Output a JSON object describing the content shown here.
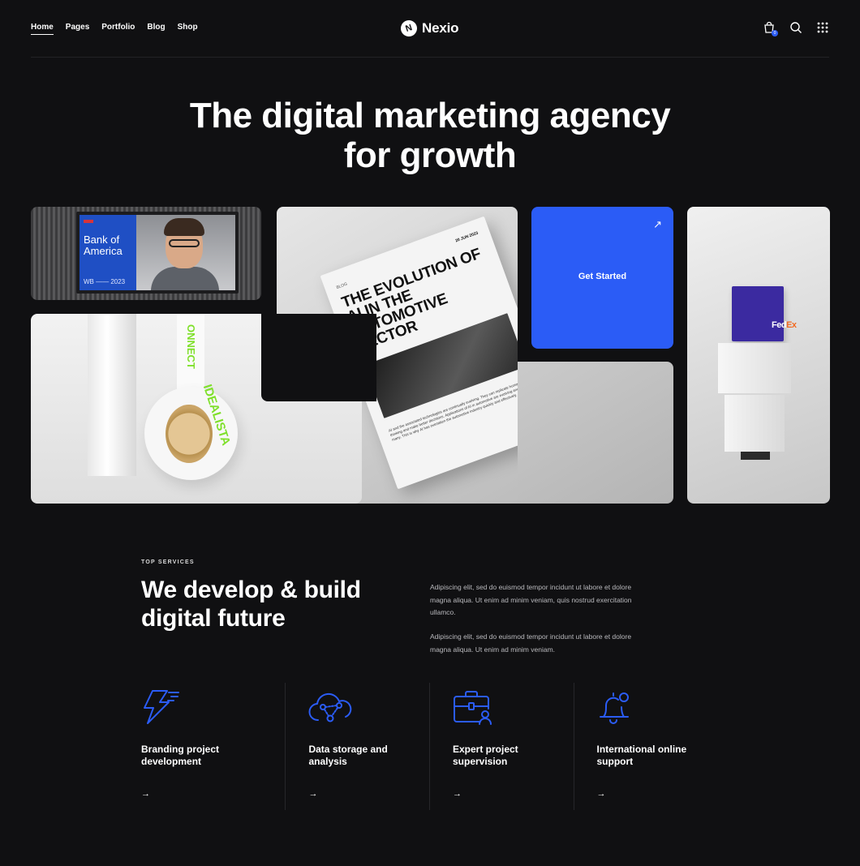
{
  "header": {
    "nav": [
      "Home",
      "Pages",
      "Portfolio",
      "Blog",
      "Shop"
    ],
    "active_nav": "Home",
    "logo_mark": "N",
    "logo_text": "Nexio",
    "cart_count": "0",
    "icons": [
      "shopping-bag-icon",
      "search-icon",
      "grid-menu-icon"
    ]
  },
  "hero": {
    "title_line1": "The digital marketing agency",
    "title_line2": "for growth"
  },
  "gallery": {
    "billboard": {
      "brand": "Bank of America",
      "year": "WB —— 2023"
    },
    "magazine": {
      "tag": "BLOG",
      "date": "20 JUN 2023",
      "title": "THE EVOLUTION OF AI IN THE AUTOMOTIVE SECTOR",
      "body": "AI and the associated technologies are continually evolving. They can replicate human thinking and make better decisions. Applications of AI in automotive are evolving and so have many. This is why AI has overtaken the automotive industry quickly and effectively."
    },
    "cta": {
      "label": "Get Started",
      "arrow": "↗"
    },
    "tape": {
      "strap_text": "ONNECT",
      "roll_text": "IDEALISTA"
    },
    "fedex": {
      "brand_fed": "Fed",
      "brand_ex": "Ex"
    }
  },
  "services": {
    "eyebrow": "TOP SERVICES",
    "title": "We develop & build digital future",
    "paragraph1": "Adipiscing elit, sed do euismod tempor incidunt ut labore et dolore magna aliqua. Ut enim ad minim veniam, quis nostrud exercitation ullamco.",
    "paragraph2": "Adipiscing elit, sed do euismod tempor incidunt ut labore et dolore magna aliqua. Ut enim ad minim veniam.",
    "cards": [
      {
        "icon": "lightning-icon",
        "title": "Branding project development",
        "arrow": "→"
      },
      {
        "icon": "cloud-network-icon",
        "title": "Data storage and analysis",
        "arrow": "→"
      },
      {
        "icon": "briefcase-user-icon",
        "title": "Expert project supervision",
        "arrow": "→"
      },
      {
        "icon": "bell-icon",
        "title": "International online support",
        "arrow": "→"
      }
    ]
  },
  "colors": {
    "background": "#101012",
    "accent": "#2b5cf6",
    "text": "#ffffff",
    "muted_text": "#b9b9bd"
  }
}
